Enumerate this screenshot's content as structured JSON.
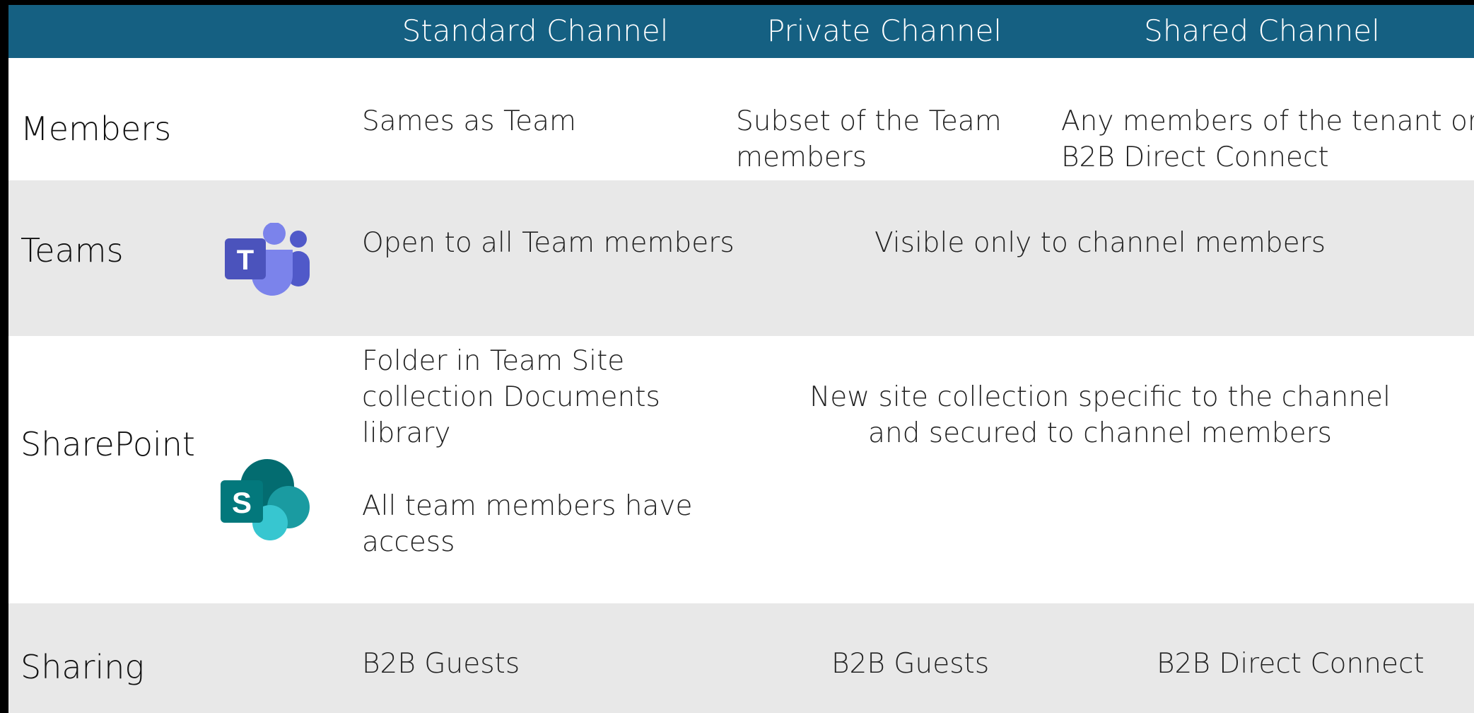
{
  "header": {
    "columns": [
      "Standard Channel",
      "Private Channel",
      "Shared Channel"
    ]
  },
  "rows": {
    "members": {
      "label": "Members",
      "standard": "Sames as Team",
      "private_l1": "Subset of the Team",
      "private_l2": "members",
      "shared_l1": "Any members of the tenant or",
      "shared_l2": "B2B Direct Connect"
    },
    "teams": {
      "label": "Teams",
      "icon": "microsoft-teams-icon",
      "standard": "Open to all Team members",
      "private_shared": "Visible only to channel members"
    },
    "sharepoint": {
      "label": "SharePoint",
      "icon": "sharepoint-icon",
      "standard_l1": "Folder in Team Site",
      "standard_l2": "collection Documents",
      "standard_l3": "library",
      "standard_l4": "All team members have",
      "standard_l5": "access",
      "private_shared_l1": "New site collection specific to the channel",
      "private_shared_l2": "and secured to channel members"
    },
    "sharing": {
      "label": "Sharing",
      "standard": "B2B Guests",
      "private": "B2B Guests",
      "shared": "B2B Direct Connect"
    }
  },
  "colors": {
    "header_bg": "#156082",
    "row_alt_bg": "#e8e8e8",
    "teams_purple": "#5059c9",
    "sharepoint_teal": "#036c70"
  }
}
